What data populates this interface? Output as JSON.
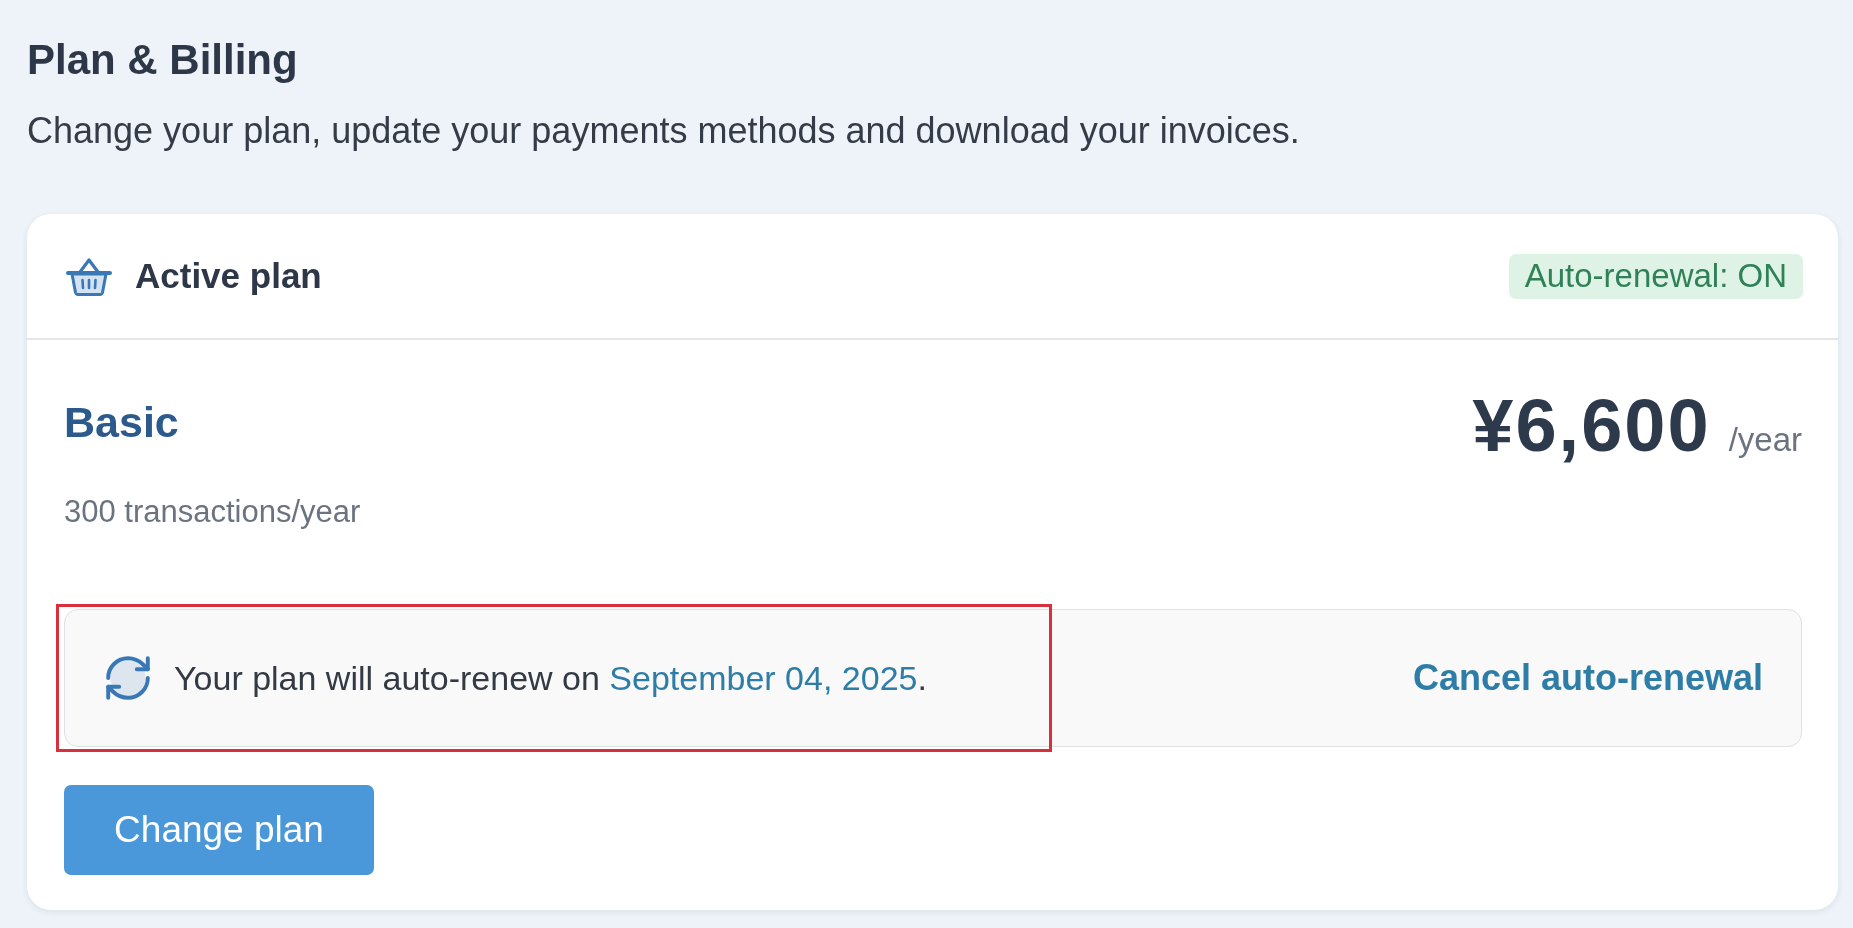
{
  "page": {
    "title": "Plan & Billing",
    "subtitle": "Change your plan, update your payments methods and download your invoices."
  },
  "active_plan": {
    "title": "Active plan",
    "auto_renewal_badge": {
      "label": "Auto-renewal: ON",
      "on": true
    },
    "plan": {
      "name": "Basic",
      "limit": "300 transactions/year",
      "price": "¥6,600",
      "period": "/year"
    },
    "renewal": {
      "message": "Your plan will auto-renew on",
      "date": "September 04, 2025",
      "end": ".",
      "highlighted": true,
      "action": "Cancel auto-renewal"
    },
    "button": "Change plan"
  }
}
